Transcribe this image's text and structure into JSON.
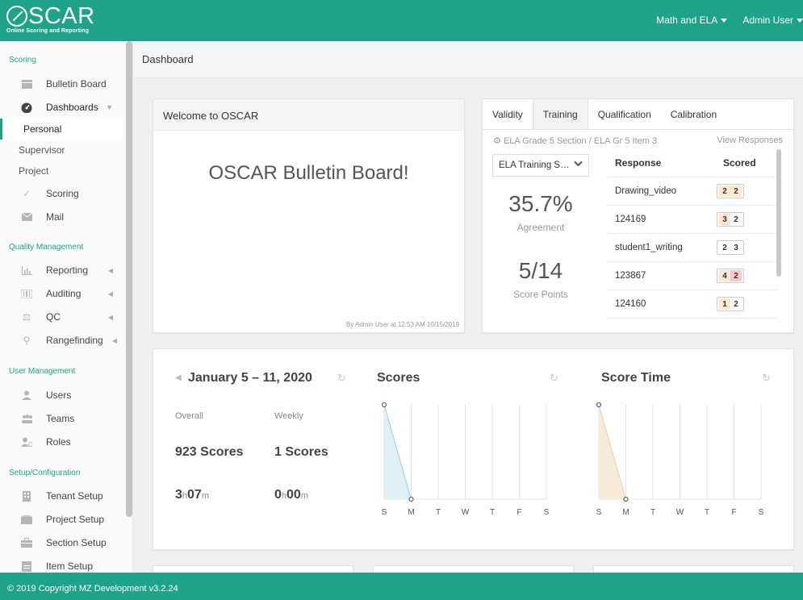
{
  "app": {
    "logo_text": "SCAR",
    "logo_sub": "Online Scoring and Reporting",
    "nav": [
      {
        "label": "Math and ELA"
      },
      {
        "label": "Admin User"
      }
    ]
  },
  "sidebar": {
    "sections": {
      "scoring": "Scoring",
      "quality": "Quality Management",
      "users": "User Management",
      "setup": "Setup/Configuration"
    },
    "items": {
      "bulletin": "Bulletin Board",
      "dashboards": "Dashboards",
      "personal": "Personal",
      "supervisor": "Supervisor",
      "project": "Project",
      "scoring": "Scoring",
      "mail": "Mail",
      "reporting": "Reporting",
      "auditing": "Auditing",
      "qc": "QC",
      "rangefinding": "Rangefinding",
      "users": "Users",
      "teams": "Teams",
      "roles": "Roles",
      "tenant": "Tenant Setup",
      "project_setup": "Project Setup",
      "section_setup": "Section Setup",
      "item_setup": "Item Setup"
    }
  },
  "page": {
    "title": "Dashboard"
  },
  "welcome": {
    "title": "Welcome to OSCAR",
    "headline": "OSCAR Bulletin Board!",
    "footer": "By Admin User at 12:53 AM 10/15/2019"
  },
  "validity": {
    "tabs": [
      "Validity",
      "Training",
      "Qualification",
      "Calibration"
    ],
    "active_tab": "Training",
    "breadcrumb": "ELA Grade 5 Section / ELA Gr 5 Item 3",
    "view_responses": "View Responses",
    "select_value": "ELA Training S…",
    "agreement_value": "35.7%",
    "agreement_label": "Agreement",
    "points_value": "5/14",
    "points_label": "Score Points",
    "col_response": "Response",
    "col_scored": "Scored",
    "rows": [
      {
        "name": "Drawing_video",
        "a": "2",
        "b": "2",
        "a_color": "#fde9d2",
        "b_color": "#fde9d2"
      },
      {
        "name": "124169",
        "a": "3",
        "b": "2",
        "a_color": "#fde9d2",
        "b_color": "#ffffff"
      },
      {
        "name": "student1_writing",
        "a": "2",
        "b": "3",
        "a_color": "#ffffff",
        "b_color": "#ffffff"
      },
      {
        "name": "123867",
        "a": "4",
        "b": "2",
        "a_color": "#fde9d2",
        "b_color": "#f9c6cb"
      },
      {
        "name": "124160",
        "a": "1",
        "b": "2",
        "a_color": "#fde9d2",
        "b_color": "#ffffff"
      }
    ]
  },
  "stats": {
    "week": "January 5 – 11, 2020",
    "overall_label": "Overall",
    "weekly_label": "Weekly",
    "overall_scores": "923 Scores",
    "weekly_scores": "1 Scores",
    "overall_time_h": "3",
    "overall_time_m": "07",
    "weekly_time_h": "0",
    "weekly_time_m": "00",
    "h_unit": "h",
    "m_unit": "m"
  },
  "chart_data": [
    {
      "type": "area",
      "title": "Scores",
      "categories": [
        "S",
        "M",
        "T",
        "W",
        "T",
        "F",
        "S"
      ],
      "values": [
        1,
        0,
        null,
        null,
        null,
        null,
        null
      ],
      "color": "#dff0f7",
      "stroke": "#9ccfe4"
    },
    {
      "type": "area",
      "title": "Score Time",
      "categories": [
        "S",
        "M",
        "T",
        "W",
        "T",
        "F",
        "S"
      ],
      "values": [
        1,
        0,
        null,
        null,
        null,
        null,
        null
      ],
      "color": "#f7ead9",
      "stroke": "#e6cfac"
    }
  ],
  "footer": {
    "text": "© 2019 Copyright MZ Development v3.2.24"
  }
}
